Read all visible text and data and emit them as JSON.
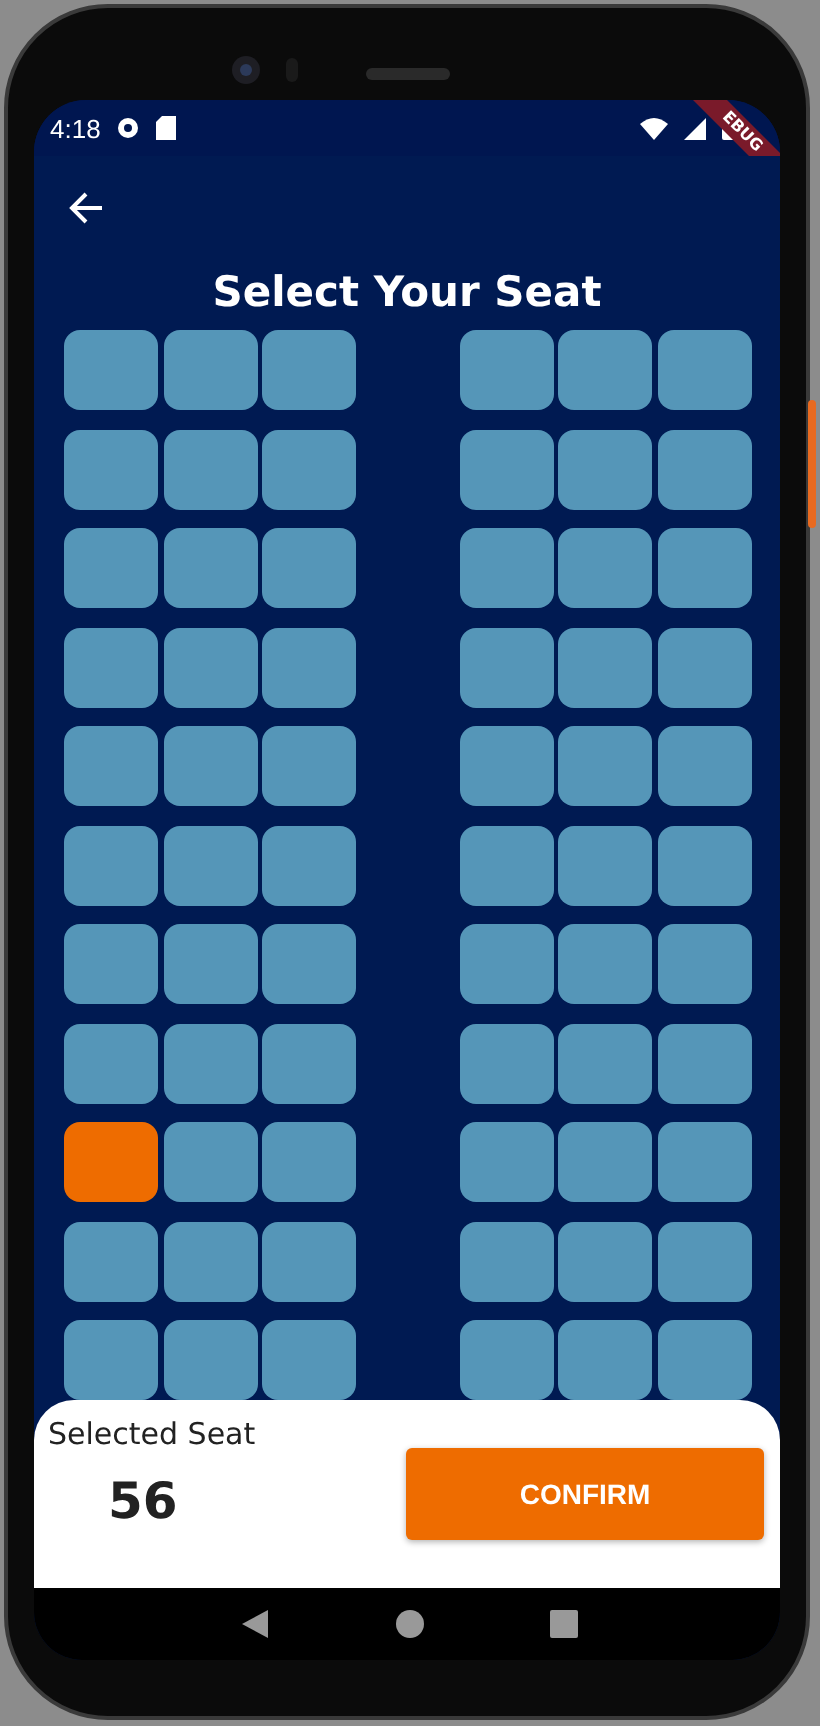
{
  "status_bar": {
    "time": "4:18"
  },
  "debug_banner": "EBUG",
  "title": "Select Your Seat",
  "seat_rows": [
    {
      "seats": [
        {
          "selected": false
        },
        {
          "selected": false
        },
        {
          "selected": false
        },
        {
          "selected": false
        },
        {
          "selected": false
        },
        {
          "selected": false
        }
      ]
    },
    {
      "seats": [
        {
          "selected": false
        },
        {
          "selected": false
        },
        {
          "selected": false
        },
        {
          "selected": false
        },
        {
          "selected": false
        },
        {
          "selected": false
        }
      ]
    },
    {
      "seats": [
        {
          "selected": false
        },
        {
          "selected": false
        },
        {
          "selected": false
        },
        {
          "selected": false
        },
        {
          "selected": false
        },
        {
          "selected": false
        }
      ]
    },
    {
      "seats": [
        {
          "selected": false
        },
        {
          "selected": false
        },
        {
          "selected": false
        },
        {
          "selected": false
        },
        {
          "selected": false
        },
        {
          "selected": false
        }
      ]
    },
    {
      "seats": [
        {
          "selected": false
        },
        {
          "selected": false
        },
        {
          "selected": false
        },
        {
          "selected": false
        },
        {
          "selected": false
        },
        {
          "selected": false
        }
      ]
    },
    {
      "seats": [
        {
          "selected": false
        },
        {
          "selected": false
        },
        {
          "selected": false
        },
        {
          "selected": false
        },
        {
          "selected": false
        },
        {
          "selected": false
        }
      ]
    },
    {
      "seats": [
        {
          "selected": false
        },
        {
          "selected": false
        },
        {
          "selected": false
        },
        {
          "selected": false
        },
        {
          "selected": false
        },
        {
          "selected": false
        }
      ]
    },
    {
      "seats": [
        {
          "selected": false
        },
        {
          "selected": false
        },
        {
          "selected": false
        },
        {
          "selected": false
        },
        {
          "selected": false
        },
        {
          "selected": false
        }
      ]
    },
    {
      "seats": [
        {
          "selected": true
        },
        {
          "selected": false
        },
        {
          "selected": false
        },
        {
          "selected": false
        },
        {
          "selected": false
        },
        {
          "selected": false
        }
      ]
    },
    {
      "seats": [
        {
          "selected": false
        },
        {
          "selected": false
        },
        {
          "selected": false
        },
        {
          "selected": false
        },
        {
          "selected": false
        },
        {
          "selected": false
        }
      ]
    },
    {
      "seats": [
        {
          "selected": false
        },
        {
          "selected": false
        },
        {
          "selected": false
        },
        {
          "selected": false
        },
        {
          "selected": false
        },
        {
          "selected": false
        }
      ]
    }
  ],
  "selection": {
    "label": "Selected Seat",
    "value": "56"
  },
  "confirm_button": "CONFIRM"
}
